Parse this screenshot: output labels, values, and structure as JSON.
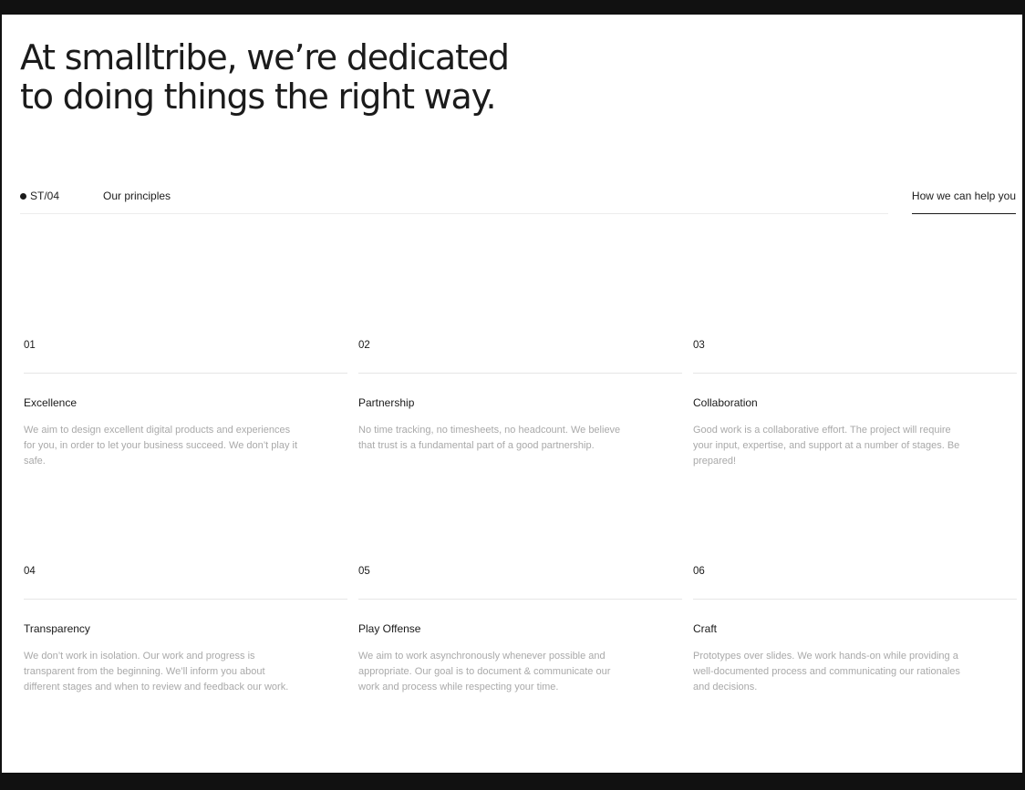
{
  "headline": {
    "line1": "At smalltribe, we’re dedicated",
    "line2": "to doing things the right way."
  },
  "section": {
    "code": "ST/04",
    "title": "Our principles",
    "help_link": "How we can help you"
  },
  "principles": [
    {
      "number": "01",
      "title": "Excellence",
      "body": "We aim to design excellent digital products and experiences for you, in order to let your business succeed. We don’t play it safe."
    },
    {
      "number": "02",
      "title": "Partnership",
      "body": "No time tracking, no timesheets, no headcount. We believe that trust is a fundamental part of a good partnership."
    },
    {
      "number": "03",
      "title": "Collaboration",
      "body": "Good work is a collaborative effort. The project will require your input, expertise, and support at a number of stages. Be prepared!"
    },
    {
      "number": "04",
      "title": "Transparency",
      "body": "We don’t work in isolation. Our work and progress is transparent from the beginning. We’ll inform you about different stages and when to review and feedback our work."
    },
    {
      "number": "05",
      "title": "Play Offense",
      "body": "We aim to work asynchronously whenever possible and appropriate. Our goal is to document & communicate our work and process while respecting your time."
    },
    {
      "number": "06",
      "title": "Craft",
      "body": "Prototypes over slides. We work hands-on while providing a well-documented process and communicating our rationales and decisions."
    }
  ],
  "colors": {
    "background": "#ffffff",
    "frame": "#111111",
    "text": "#1a1a1a",
    "muted_text": "#a9a9a9",
    "rule": "#e6e6e6"
  }
}
